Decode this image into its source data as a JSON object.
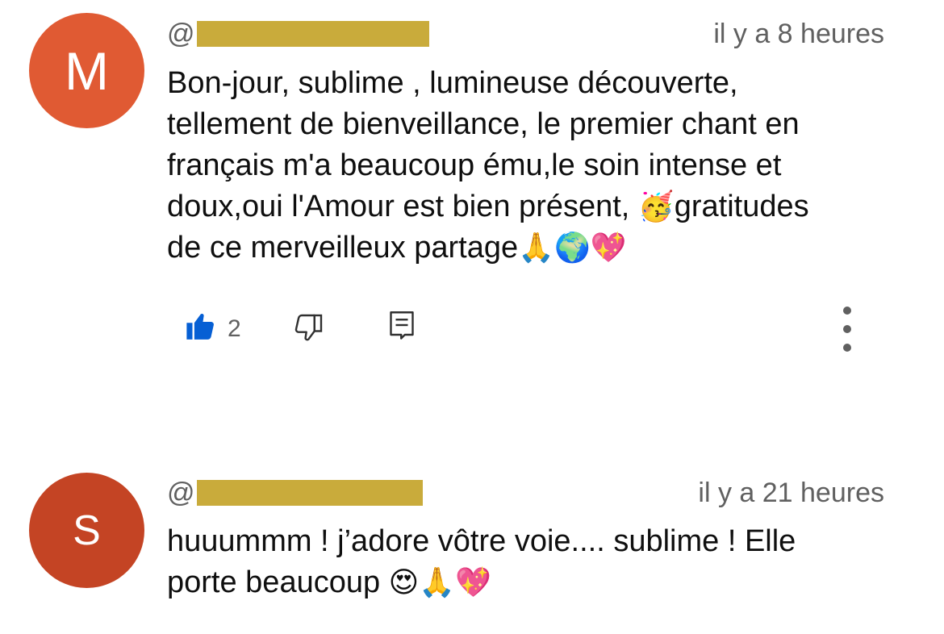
{
  "comments": [
    {
      "avatar_letter": "M",
      "avatar_color": "#e05a33",
      "handle_prefix": "@",
      "handle_redaction_color": "#c9ab3b",
      "timestamp": "il y a 8 heures",
      "lines": [
        "Bon-jour, sublime , lumineuse découverte,",
        "tellement de bienveillance, le premier chant en",
        "français m'a beaucoup ému,le soin intense et",
        "doux,oui l'Amour est bien présent, "
      ],
      "line4_emoji": "🥳",
      "line4_rest": "gratitudes",
      "line5": "de ce merveilleux partage",
      "line5_emojis": "🙏🌍💖",
      "like_count": "2",
      "icons": {
        "like": "thumbs-up-filled-icon",
        "dislike": "thumbs-down-outline-icon",
        "reply": "reply-comment-icon",
        "more": "more-vertical-icon"
      },
      "like_color": "#065fd4"
    },
    {
      "avatar_letter": "S",
      "avatar_color": "#c44424",
      "handle_prefix": "@",
      "handle_redaction_color": "#c9ab3b",
      "timestamp": "il y a 21 heures",
      "lines": [
        "huuummm ! j’adore vôtre voie.... sublime ! Elle",
        "porte beaucoup "
      ],
      "line2_emojis": "😍🙏💖"
    }
  ]
}
